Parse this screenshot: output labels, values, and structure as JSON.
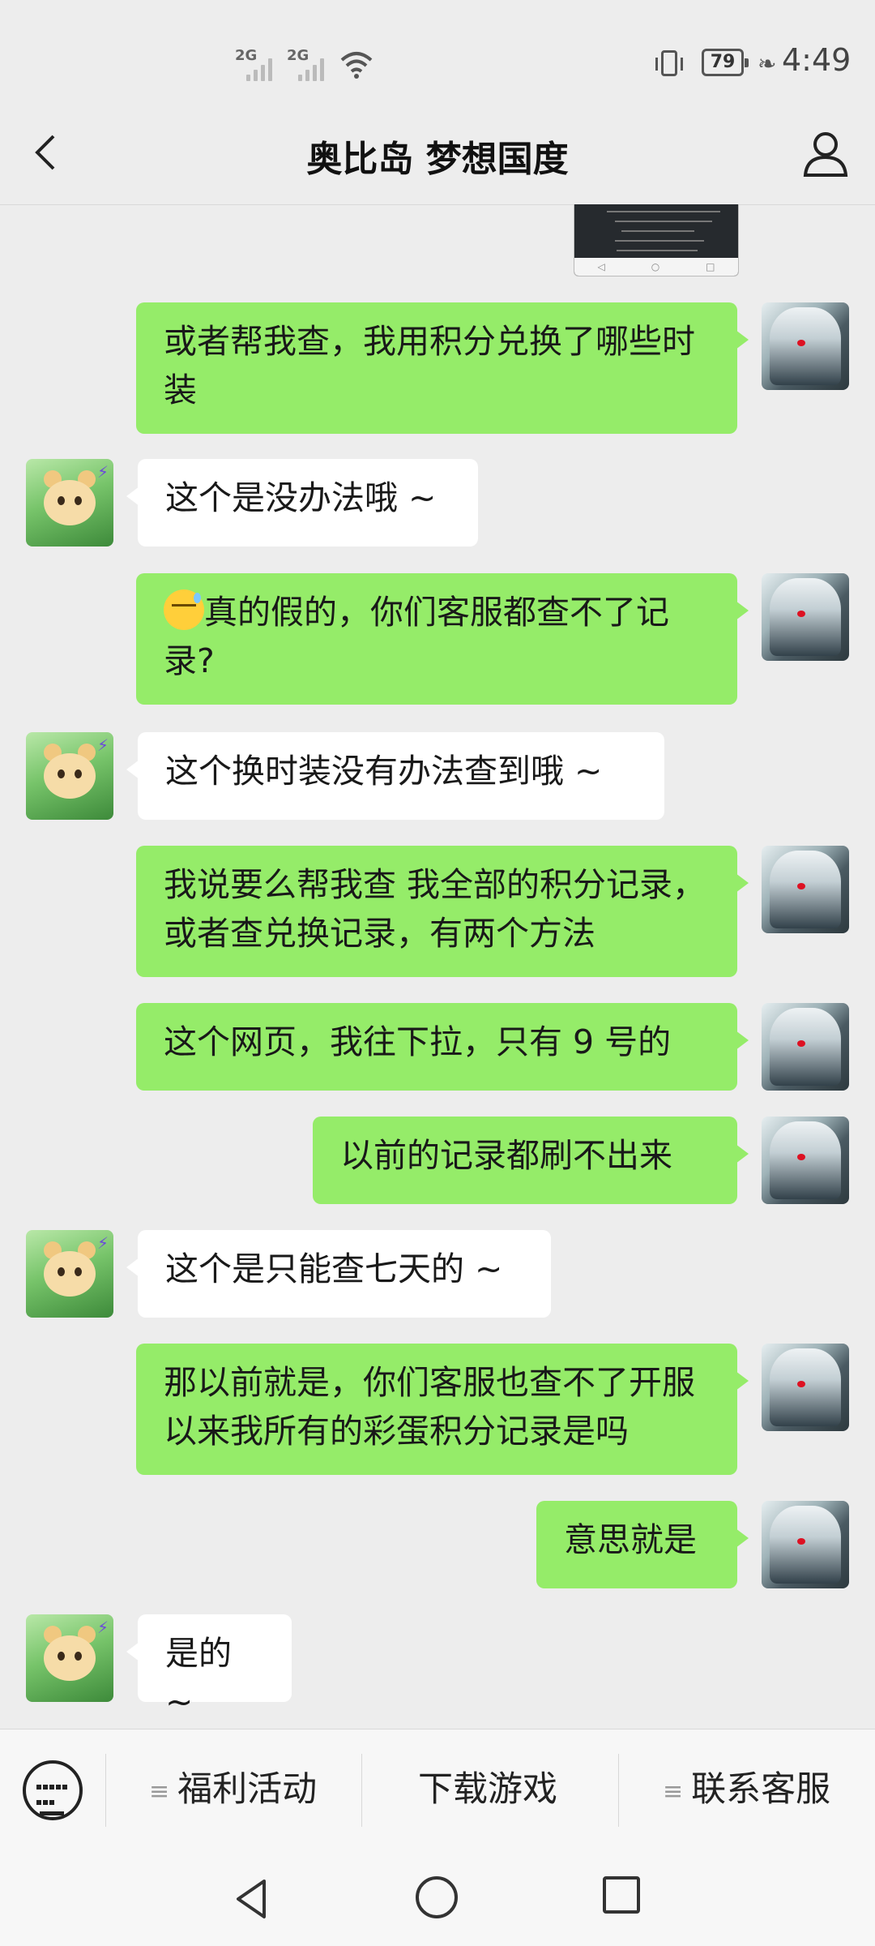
{
  "status": {
    "sim1": "2G",
    "sim2": "2G",
    "battery": "79",
    "time": "4:49"
  },
  "header": {
    "title": "奥比岛 梦想国度"
  },
  "messages": [
    {
      "from": "me",
      "text": "或者帮我查，我用积分兑换了哪些时装"
    },
    {
      "from": "them",
      "text": "这个是没办法哦 ~"
    },
    {
      "from": "me",
      "text": "真的假的，你们客服都查不了记录?"
    },
    {
      "from": "them",
      "text": "这个换时装没有办法查到哦 ~"
    },
    {
      "from": "me",
      "text": "我说要么帮我查 我全部的积分记录，或者查兑换记录，有两个方法"
    },
    {
      "from": "me",
      "text": "这个网页，我往下拉，只有 9 号的"
    },
    {
      "from": "me",
      "text": "以前的记录都刷不出来"
    },
    {
      "from": "them",
      "text": "这个是只能查七天的 ~"
    },
    {
      "from": "me",
      "text": "那以前就是，你们客服也查不了开服以来我所有的彩蛋积分记录是吗"
    },
    {
      "from": "me",
      "text": "意思就是"
    },
    {
      "from": "them",
      "text": "是的 ~"
    }
  ],
  "menu": {
    "item1": "福利活动",
    "item2": "下载游戏",
    "item3": "联系客服"
  }
}
